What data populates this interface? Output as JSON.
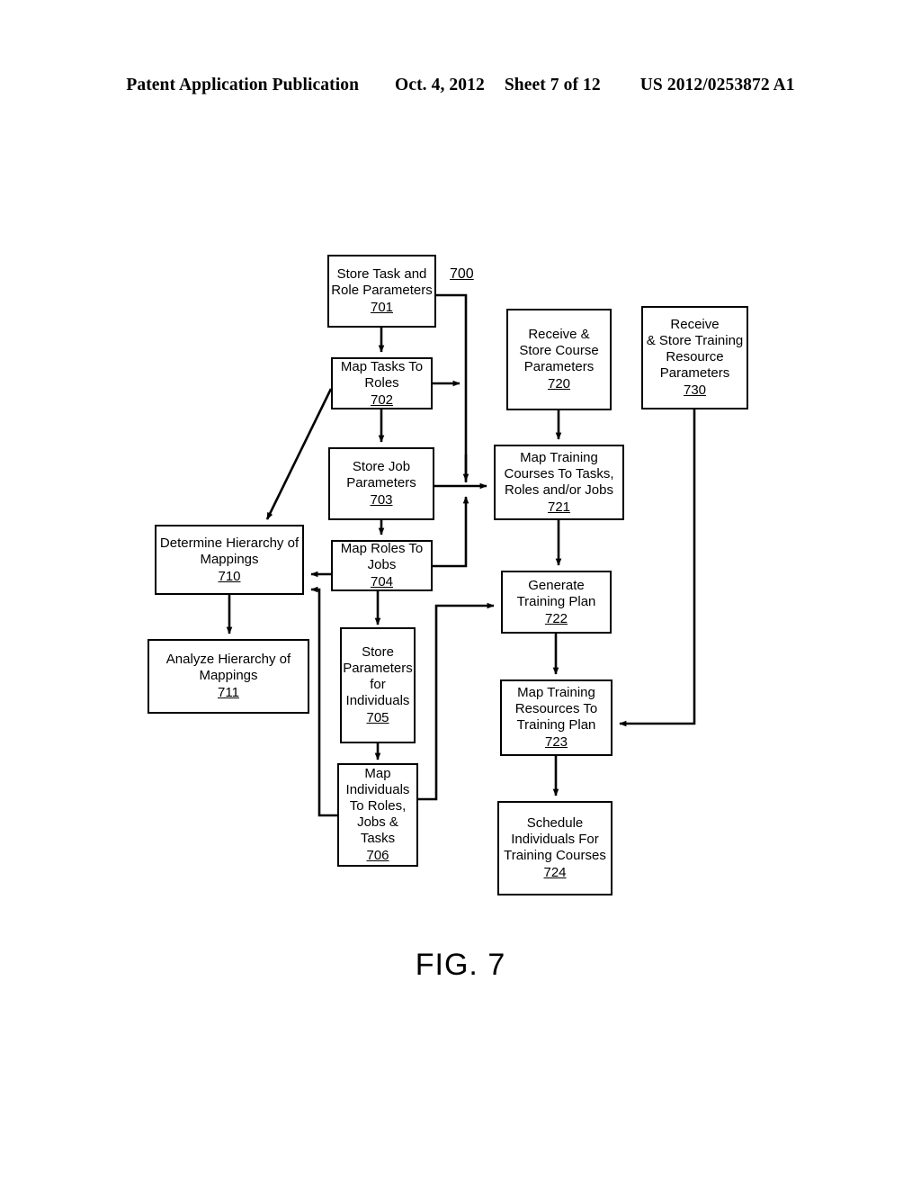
{
  "header": {
    "publication": "Patent Application Publication",
    "date": "Oct. 4, 2012",
    "sheet": "Sheet 7 of 12",
    "number": "US 2012/0253872 A1"
  },
  "figure": {
    "caption": "FIG. 7",
    "flow_ref": "700"
  },
  "nodes": [
    {
      "id": "n701",
      "label": "Store Task and\nRole Parameters",
      "ref": "701"
    },
    {
      "id": "n702",
      "label": "Map Tasks To\nRoles",
      "ref": "702"
    },
    {
      "id": "n703",
      "label": "Store Job\nParameters",
      "ref": "703"
    },
    {
      "id": "n704",
      "label": "Map Roles To\nJobs",
      "ref": "704"
    },
    {
      "id": "n705",
      "label": "Store\nParameters\nfor\nIndividuals",
      "ref": "705"
    },
    {
      "id": "n706",
      "label": "Map\nIndividuals\nTo Roles,\nJobs &\nTasks",
      "ref": "706"
    },
    {
      "id": "n710",
      "label": "Determine Hierarchy of\nMappings",
      "ref": "710"
    },
    {
      "id": "n711",
      "label": "Analyze Hierarchy of\nMappings",
      "ref": "711"
    },
    {
      "id": "n720",
      "label": "Receive &\nStore Course\nParameters",
      "ref": "720"
    },
    {
      "id": "n721",
      "label": "Map Training\nCourses To Tasks,\nRoles and/or Jobs",
      "ref": "721"
    },
    {
      "id": "n722",
      "label": "Generate\nTraining Plan",
      "ref": "722"
    },
    {
      "id": "n723",
      "label": "Map Training\nResources To\nTraining Plan",
      "ref": "723"
    },
    {
      "id": "n724",
      "label": "Schedule\nIndividuals For\nTraining Courses",
      "ref": "724"
    },
    {
      "id": "n730",
      "label": "Receive\n& Store Training\nResource\nParameters",
      "ref": "730"
    }
  ],
  "colors": {
    "ink": "#000000",
    "paper": "#ffffff"
  }
}
